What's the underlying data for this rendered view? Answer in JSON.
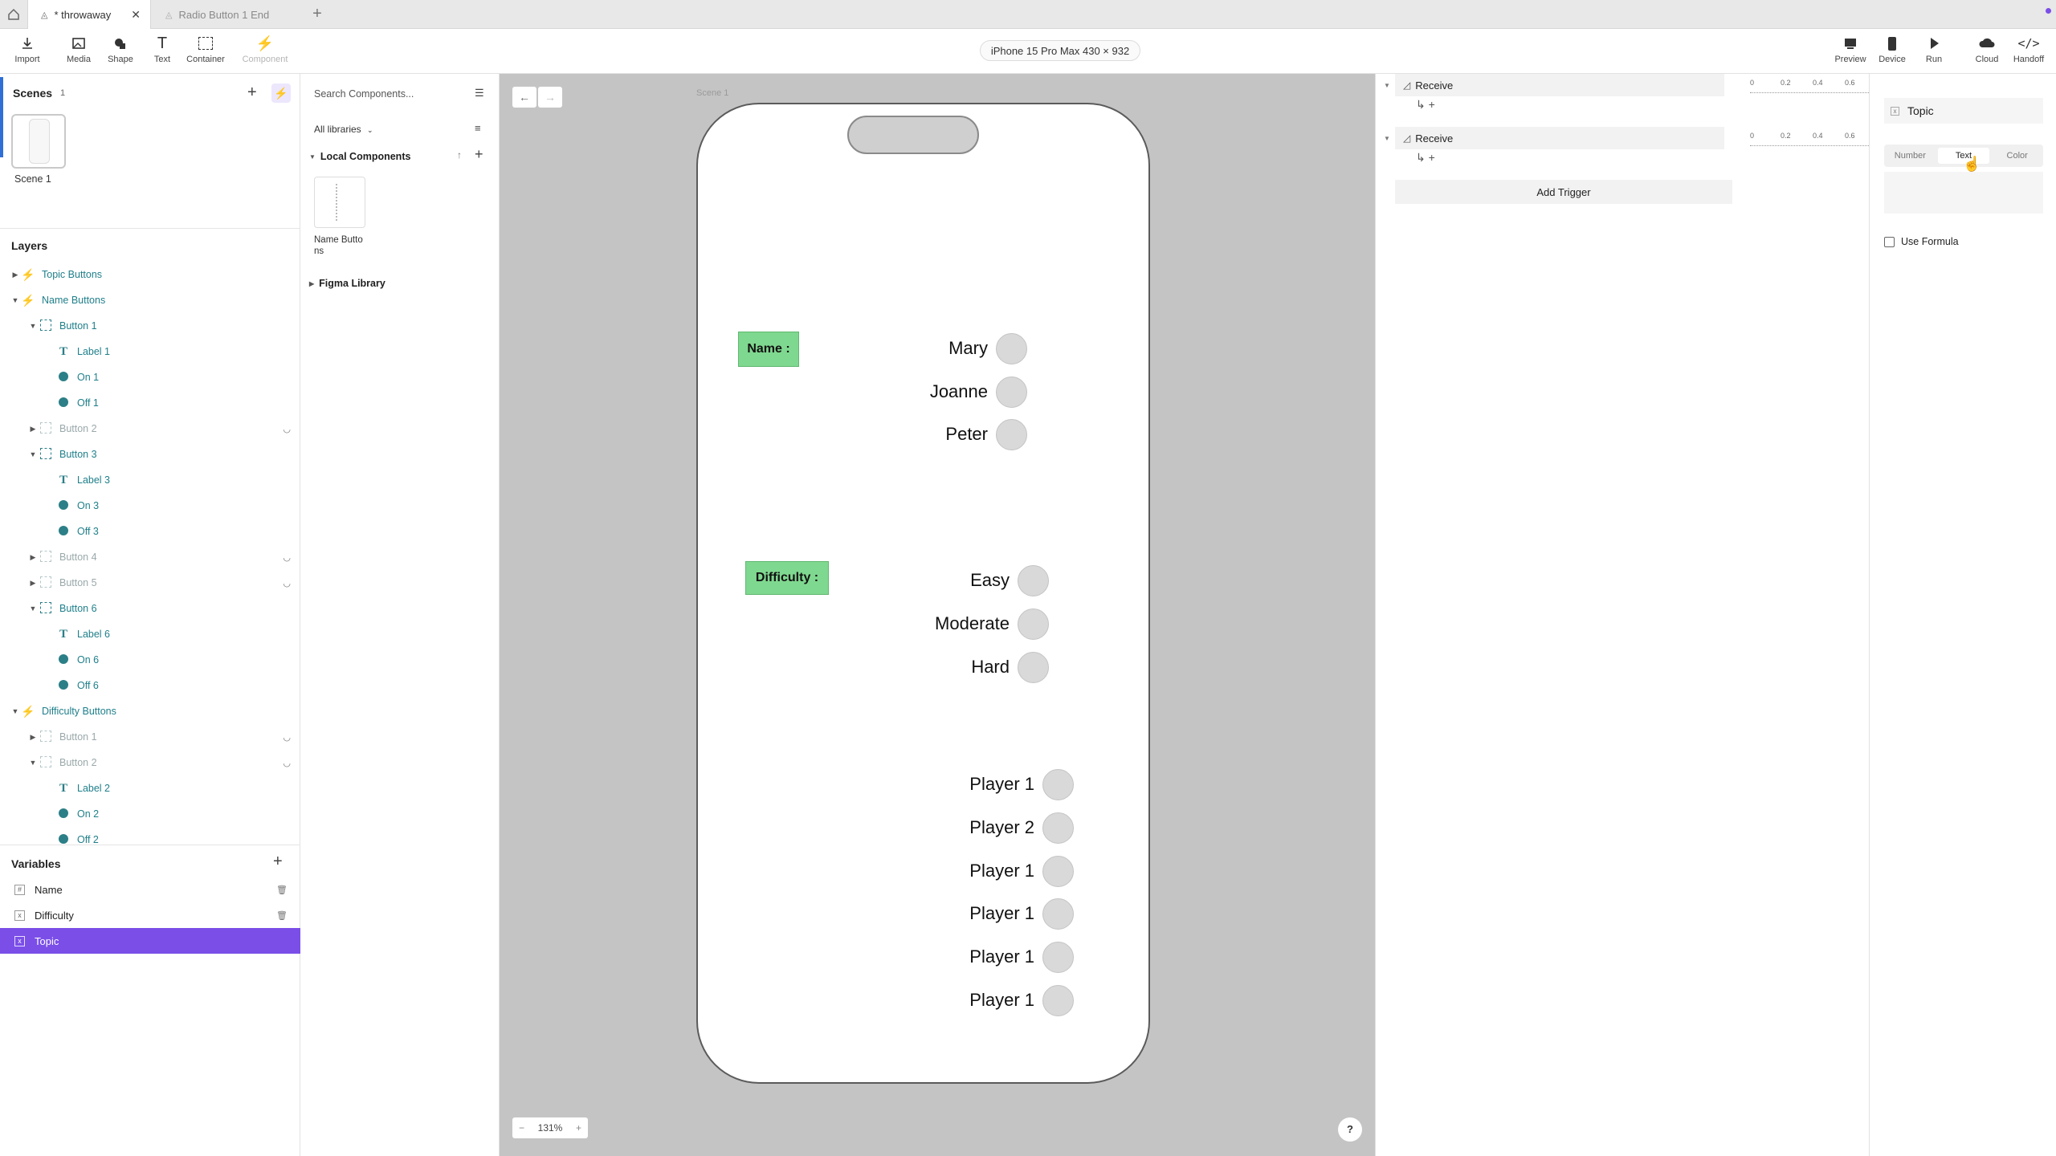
{
  "tabs": [
    {
      "label": "* throwaway"
    },
    {
      "label": "Radio Button 1 End"
    }
  ],
  "toolbar": {
    "tools": [
      "Import",
      "Media",
      "Shape",
      "Text",
      "Container",
      "Component"
    ],
    "device": "iPhone 15 Pro Max  430 × 932",
    "right_tools": [
      "Preview",
      "Device",
      "Run",
      "Cloud",
      "Handoff"
    ]
  },
  "scenes": {
    "title": "Scenes",
    "count": "1",
    "items": [
      {
        "label": "Scene 1"
      }
    ]
  },
  "layers": {
    "title": "Layers",
    "rows": [
      {
        "label": "Topic Buttons"
      },
      {
        "label": "Name Buttons"
      },
      {
        "label": "Button 1"
      },
      {
        "label": "Label 1"
      },
      {
        "label": "On 1"
      },
      {
        "label": "Off 1"
      },
      {
        "label": "Button 2"
      },
      {
        "label": "Button 3"
      },
      {
        "label": "Label 3"
      },
      {
        "label": "On 3"
      },
      {
        "label": "Off 3"
      },
      {
        "label": "Button 4"
      },
      {
        "label": "Button 5"
      },
      {
        "label": "Button 6"
      },
      {
        "label": "Label 6"
      },
      {
        "label": "On 6"
      },
      {
        "label": "Off 6"
      },
      {
        "label": "Difficulty Buttons"
      },
      {
        "label": "Button 1"
      },
      {
        "label": "Button 2"
      },
      {
        "label": "Label 2"
      },
      {
        "label": "On 2"
      },
      {
        "label": "Off 2"
      }
    ]
  },
  "variables": {
    "title": "Variables",
    "items": [
      {
        "label": "Name"
      },
      {
        "label": "Difficulty"
      },
      {
        "label": "Topic"
      }
    ]
  },
  "components": {
    "search_placeholder": "Search Components...",
    "library_filter": "All libraries",
    "local_title": "Local Components",
    "local_item": "Name Butto ns",
    "figma_library": "Figma Library"
  },
  "canvas": {
    "scene_label": "Scene 1",
    "zoom": "131%",
    "help": "?",
    "name_label": "Name :",
    "difficulty_label": "Difficulty :",
    "names": [
      "Mary",
      "Joanne",
      "Peter"
    ],
    "difficulties": [
      "Easy",
      "Moderate",
      "Hard"
    ],
    "players": [
      "Player 1",
      "Player 2",
      "Player 1",
      "Player 1",
      "Player 1",
      "Player 1"
    ]
  },
  "triggers": {
    "rows": [
      {
        "label": "Receive"
      },
      {
        "label": "Receive"
      }
    ],
    "ruler_ticks": [
      "0",
      "0.2",
      "0.4",
      "0.6"
    ],
    "add_trigger": "Add Trigger"
  },
  "inspector": {
    "variable_name": "Topic",
    "segments": [
      "Number",
      "Text",
      "Color"
    ],
    "use_formula": "Use Formula"
  },
  "colors": {
    "accent_purple": "#7b4ee8",
    "teal": "#2c7f87",
    "label_green": "#7fd88f",
    "canvas_bg": "#c4c4c4"
  }
}
